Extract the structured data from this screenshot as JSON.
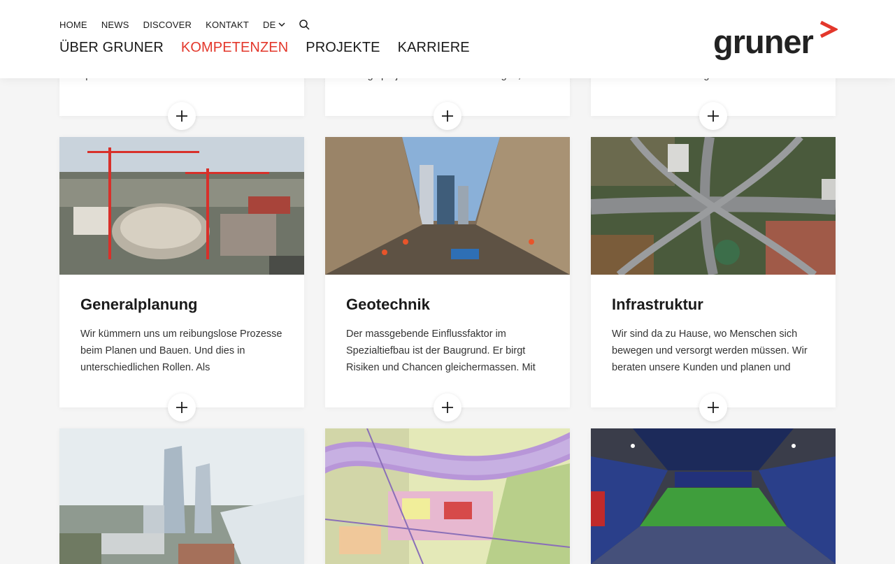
{
  "util_nav": [
    "HOME",
    "NEWS",
    "DISCOVER",
    "KONTAKT"
  ],
  "lang": "DE",
  "main_nav": [
    {
      "label": "ÜBER GRUNER",
      "active": false
    },
    {
      "label": "KOMPETENZEN",
      "active": true
    },
    {
      "label": "PROJEKTE",
      "active": false
    },
    {
      "label": "KARRIERE",
      "active": false
    }
  ],
  "logo": "gruner",
  "colors": {
    "accent": "#e3372b",
    "text": "#1a1a1a",
    "background": "#f5f5f5"
  },
  "top_cards_partial": [
    "spezifischem Know-how und inneren",
    "Energieprojekte – Produktionsanlagen,",
    "Nutzer und Besitzer gut fahren. Dabei"
  ],
  "cards": [
    {
      "title": "Generalplanung",
      "text": "Wir kümmern uns um reibungslose Prozesse beim Planen und Bauen. Und dies in unterschiedlichen Rollen. Als"
    },
    {
      "title": "Geotechnik",
      "text": "Der massgebende Einflussfaktor im Spezialtiefbau ist der Baugrund. Er birgt Risiken und Chancen gleichermassen. Mit"
    },
    {
      "title": "Infrastruktur",
      "text": "Wir sind da zu Hause, wo Menschen sich bewegen und versorgt werden müssen. Wir beraten unsere Kunden und planen und"
    }
  ]
}
